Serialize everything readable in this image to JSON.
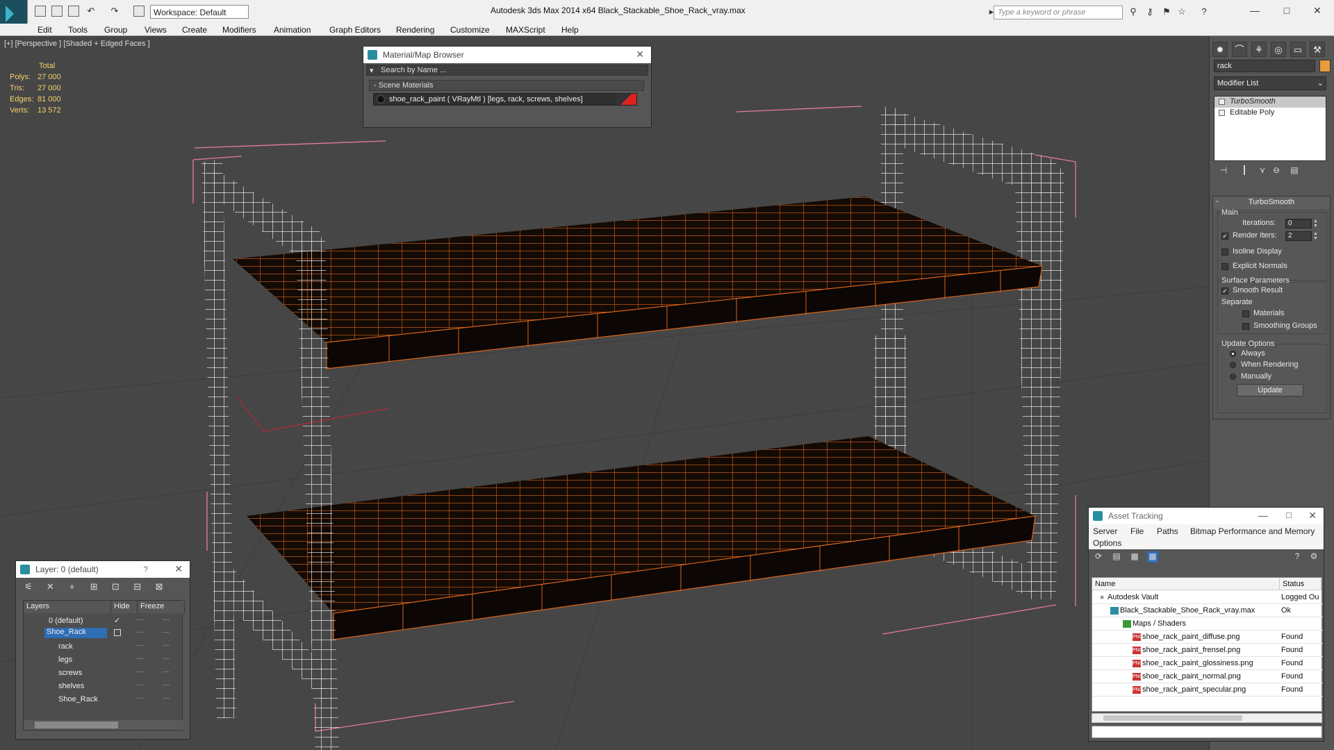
{
  "app": {
    "title": "Autodesk 3ds Max  2014 x64      Black_Stackable_Shoe_Rack_vray.max",
    "workspace": "Workspace: Default",
    "search_placeholder": "Type a keyword or phrase"
  },
  "menu": [
    "Edit",
    "Tools",
    "Group",
    "Views",
    "Create",
    "Modifiers",
    "Animation",
    "Graph Editors",
    "Rendering",
    "Customize",
    "MAXScript",
    "Help"
  ],
  "viewport": {
    "label": "[+] [Perspective ] [Shaded + Edged Faces ]",
    "stats_header": "Total",
    "stats": [
      {
        "k": "Polys:",
        "v": "27 000"
      },
      {
        "k": "Tris:",
        "v": "27 000"
      },
      {
        "k": "Edges:",
        "v": "81 000"
      },
      {
        "k": "Verts:",
        "v": "13 572"
      }
    ]
  },
  "material_browser": {
    "title": "Material/Map Browser",
    "search_placeholder": "Search by Name ...",
    "group": "- Scene Materials",
    "item": "shoe_rack_paint  ( VRayMtl ) [legs, rack, screws, shelves]"
  },
  "command_panel": {
    "object_name": "rack",
    "modifier_list": "Modifier List",
    "stack": [
      "TurboSmooth",
      "Editable Poly"
    ],
    "turbosmooth": {
      "title": "TurboSmooth",
      "main": "Main",
      "iterations_label": "Iterations:",
      "iterations": "0",
      "render_iters_label": "Render Iters:",
      "render_iters": "2",
      "isoline": "Isoline Display",
      "explicit_normals": "Explicit Normals",
      "surface_params": "Surface Parameters",
      "smooth_result": "Smooth Result",
      "separate": "Separate",
      "materials": "Materials",
      "smoothing_groups": "Smoothing Groups",
      "update_options": "Update Options",
      "always": "Always",
      "when_rendering": "When Rendering",
      "manually": "Manually",
      "update": "Update"
    }
  },
  "layer_explorer": {
    "title": "Layer: 0 (default)",
    "help": "?",
    "headers": [
      "Layers",
      "Hide",
      "Freeze"
    ],
    "rows": [
      {
        "name": "0 (default)",
        "check": "✓"
      },
      {
        "name": "Shoe_Rack",
        "check": ""
      },
      {
        "name": "rack",
        "check": ""
      },
      {
        "name": "legs",
        "check": ""
      },
      {
        "name": "screws",
        "check": ""
      },
      {
        "name": "shelves",
        "check": ""
      },
      {
        "name": "Shoe_Rack",
        "check": ""
      }
    ],
    "dash": "—"
  },
  "asset_tracking": {
    "title": "Asset Tracking",
    "menu": [
      "Server",
      "File",
      "Paths",
      "Bitmap Performance and Memory",
      "Options"
    ],
    "headers": [
      "Name",
      "Status"
    ],
    "rows": [
      {
        "name": "Autodesk Vault",
        "status": "Logged Ou",
        "indent": 22
      },
      {
        "name": "Black_Stackable_Shoe_Rack_vray.max",
        "status": "Ok",
        "indent": 40
      },
      {
        "name": "Maps / Shaders",
        "status": "",
        "indent": 58
      },
      {
        "name": "shoe_rack_paint_diffuse.png",
        "status": "Found",
        "indent": 72
      },
      {
        "name": "shoe_rack_paint_frensel.png",
        "status": "Found",
        "indent": 72
      },
      {
        "name": "shoe_rack_paint_glossiness.png",
        "status": "Found",
        "indent": 72
      },
      {
        "name": "shoe_rack_paint_normal.png",
        "status": "Found",
        "indent": 72
      },
      {
        "name": "shoe_rack_paint_specular.png",
        "status": "Found",
        "indent": 72
      }
    ],
    "png_tag": "PNG"
  },
  "colors": {
    "wire_white": "#ffffff",
    "wire_orange": "#d9651d",
    "bbox_pink": "#e879a8",
    "stats_yellow": "#f5d36b",
    "selection_blue": "#2f6db5"
  }
}
